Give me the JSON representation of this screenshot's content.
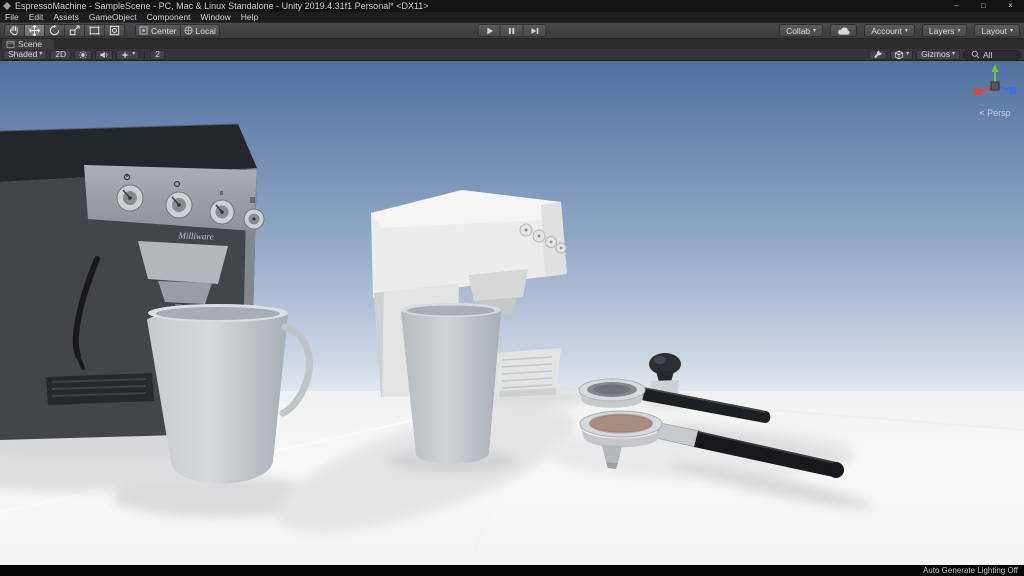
{
  "window": {
    "title": "EspressoMachine - SampleScene - PC, Mac & Linux Standalone - Unity 2019.4.31f1 Personal* <DX11>",
    "minimize": "–",
    "maximize": "□",
    "close": "×"
  },
  "menu": {
    "items": [
      "File",
      "Edit",
      "Assets",
      "GameObject",
      "Component",
      "Window",
      "Help"
    ]
  },
  "toolbar": {
    "pivot": "Center",
    "space": "Local",
    "collab": "Collab",
    "account": "Account",
    "layers": "Layers",
    "layout": "Layout",
    "dropdown_caret": "▾"
  },
  "tabs": {
    "scene": "Scene"
  },
  "scene_toolbar": {
    "shading": "Shaded",
    "mode2d": "2D",
    "msaa": "2",
    "gizmos": "Gizmos",
    "search_value": "All"
  },
  "viewport": {
    "persp_label": "< Persp",
    "brand": "Milliware"
  },
  "statusbar": {
    "lighting_status": "Auto Generate Lighting Off"
  },
  "colors": {
    "axis_x": "#d4493a",
    "axis_y": "#6fc63c",
    "axis_z": "#3d6fd8",
    "sky_top": "#50719f",
    "sky_horizon": "#e2e8ee",
    "ground": "#f5f6f6"
  }
}
